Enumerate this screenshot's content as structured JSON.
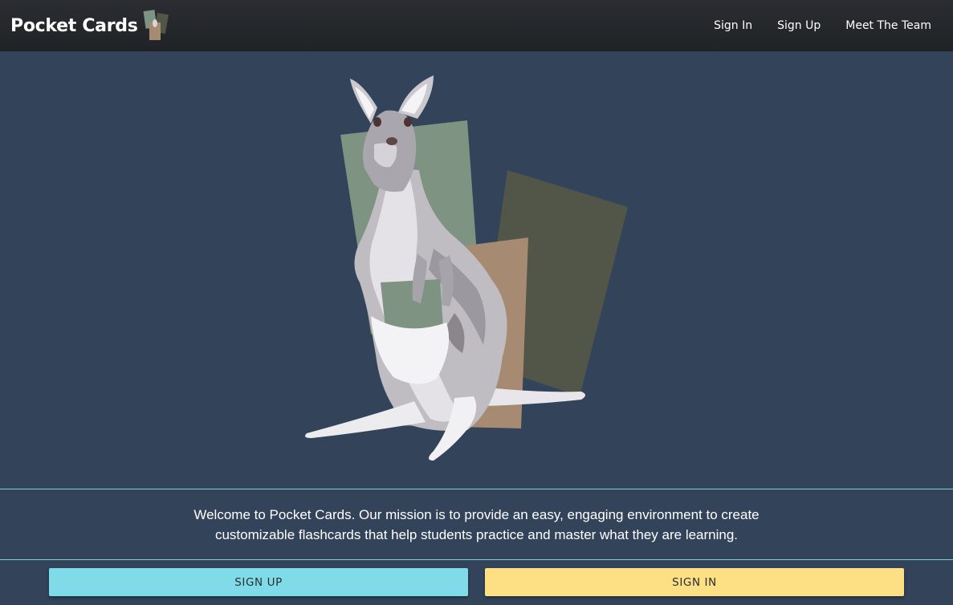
{
  "navbar": {
    "brand": "Pocket Cards",
    "links": [
      "Sign In",
      "Sign Up",
      "Meet The Team"
    ]
  },
  "hero": {
    "illustration": "kangaroo-with-flashcards"
  },
  "mission": {
    "text": "Welcome to Pocket Cards. Our mission is to provide an easy, engaging environment to create customizable flashcards that help students practice and master what they are learning."
  },
  "actions": {
    "signup_label": "SIGN UP",
    "signin_label": "SIGN IN"
  },
  "colors": {
    "background": "#32435a",
    "navbar": "#232629",
    "accent_cyan": "#7fdbe8",
    "accent_yellow": "#fde083",
    "card_green": "#7f9383",
    "card_dark": "#515649",
    "card_tan": "#a78a72"
  }
}
